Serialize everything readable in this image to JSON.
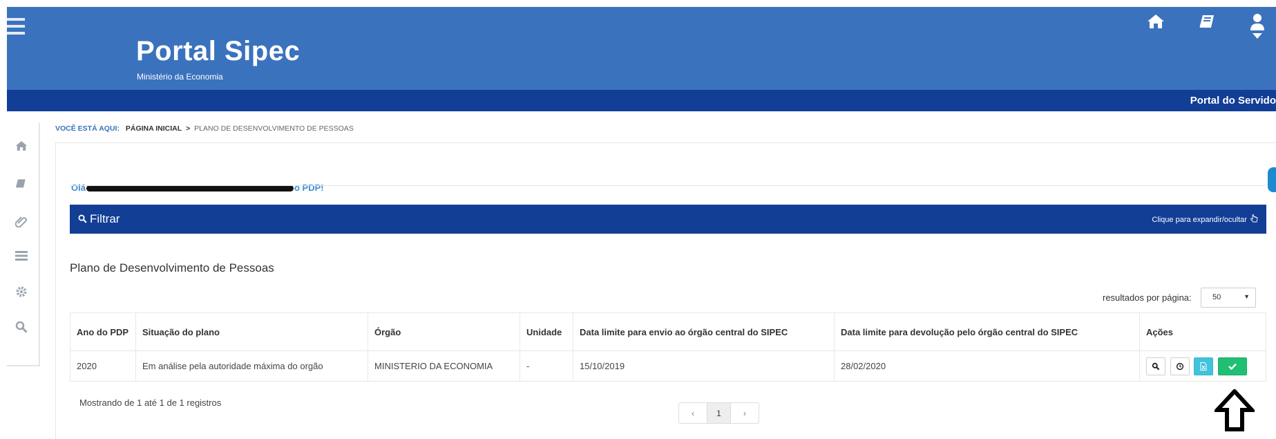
{
  "header": {
    "brand_title": "Portal Sipec",
    "brand_subtitle": "Ministério da Economia",
    "icons": [
      "menu-icon",
      "home-icon",
      "book-icon",
      "user-icon"
    ],
    "subbar_label": "Portal do Servido",
    "accent_color": "#3b72bd",
    "navy_color": "#123e96"
  },
  "sidebar": {
    "icons": [
      "home-icon",
      "book-icon",
      "paperclip-icon",
      "list-icon",
      "gear-icon",
      "search-icon"
    ]
  },
  "breadcrumb": {
    "prefix": "VOCÊ ESTÁ AQUI:",
    "home": "PÁGINA INICIAL",
    "separator": ">",
    "current": "PLANO DE DESENVOLVIMENTO DE PESSOAS"
  },
  "greeting": {
    "start": "Olá",
    "end": "o PDP!"
  },
  "filter": {
    "title": "Filtrar",
    "toggle_hint": "Clique para expandir/ocultar"
  },
  "section_title": "Plano de Desenvolvimento de Pessoas",
  "per_page": {
    "label": "resultados por página:",
    "value": "50"
  },
  "table": {
    "headers": {
      "ano": "Ano do PDP",
      "situacao": "Situação do plano",
      "orgao": "Órgão",
      "unidade": "Unidade",
      "data_envio": "Data limite para envio ao órgão central do SIPEC",
      "data_devolucao": "Data limite para devolução pelo órgão central do SIPEC",
      "acoes": "Ações"
    },
    "rows": [
      {
        "ano": "2020",
        "situacao": "Em análise pela autoridade máxima do orgão",
        "orgao": "MINISTERIO DA ECONOMIA",
        "unidade": "-",
        "data_envio": "15/10/2019",
        "data_devolucao": "28/02/2020",
        "actions": [
          "search-icon",
          "clock-icon",
          "excel-icon",
          "check-icon"
        ]
      }
    ]
  },
  "pagination": {
    "info": "Mostrando de 1 até 1 de 1 registros",
    "prev": "‹",
    "current": "1",
    "next": "›"
  }
}
